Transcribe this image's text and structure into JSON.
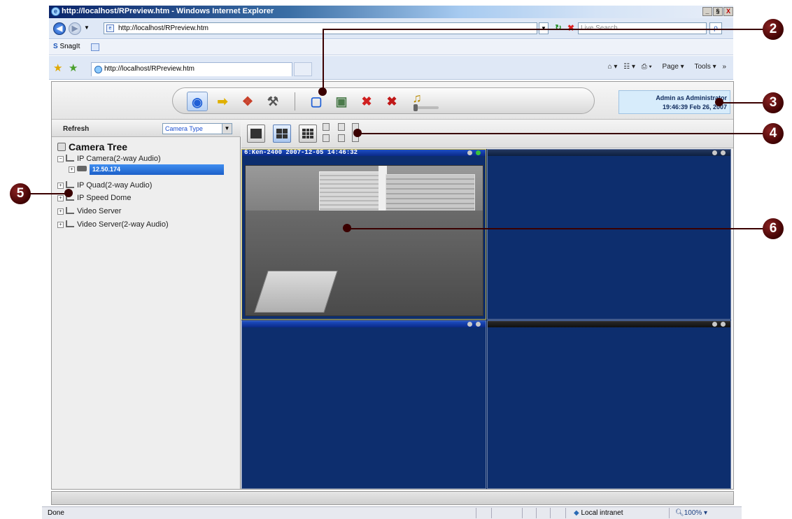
{
  "window": {
    "title": "http://localhost/RPreview.htm - Windows Internet Explorer",
    "min": "_",
    "max": "§",
    "close": "X"
  },
  "nav": {
    "address": "http://localhost/RPreview.htm",
    "search_placeholder": "Live Search",
    "back_glyph": "◀",
    "forward_glyph": "▶",
    "refresh_glyph": "↻",
    "stop_glyph": "✖",
    "search_glyph": "ρ"
  },
  "links": {
    "snagit": "SnagIt"
  },
  "favorites": {
    "tab_label": "http://localhost/RPreview.htm",
    "commands": [
      "Page",
      "Tools"
    ]
  },
  "toolbar": {
    "buttons": [
      {
        "name": "live-view",
        "icon": "eye-icon",
        "glyph": "◉",
        "color": "#1f5fd6"
      },
      {
        "name": "playback",
        "icon": "arrow-icon",
        "glyph": "➡",
        "color": "#e0b000"
      },
      {
        "name": "config",
        "icon": "puzzle-icon",
        "glyph": "❖",
        "color": "#c8402a"
      },
      {
        "name": "tools",
        "icon": "hammer-icon",
        "glyph": "⚒",
        "color": "#555555"
      },
      {
        "name": "fullscreen",
        "icon": "fullscreen-icon",
        "glyph": "▢",
        "color": "#1f5fd6"
      },
      {
        "name": "snapshot",
        "icon": "camera-icon",
        "glyph": "▣",
        "color": "#4a7a4a"
      },
      {
        "name": "disconnect",
        "icon": "disconnect-icon",
        "glyph": "✖",
        "color": "#d02020"
      },
      {
        "name": "disconnect-all",
        "icon": "disconnect-all-icon",
        "glyph": "✖",
        "color": "#c01818"
      },
      {
        "name": "audio",
        "icon": "speaker-icon",
        "glyph": "♫",
        "color": "#b88a00"
      }
    ]
  },
  "user": {
    "line1": "Admin as Administrator",
    "line2": "19:46:39 Feb 26, 2007"
  },
  "left_panel": {
    "refresh": "Refresh",
    "camera_type": "Camera Type",
    "tree_title": "Camera Tree",
    "nodes": [
      {
        "label": "IP Camera(2-way Audio)",
        "toggle": "−"
      },
      {
        "label": "IP Quad(2-way Audio)",
        "toggle": "+"
      },
      {
        "label": "IP Speed Dome",
        "toggle": "+"
      },
      {
        "label": "Video Server",
        "toggle": "+"
      },
      {
        "label": "Video Server(2-way Audio)",
        "toggle": "+"
      }
    ],
    "selected_child": "12.50.174",
    "selected_child_toggle": "+"
  },
  "video": {
    "pane1_title": "6:Ken-2400   2007-12-05 14:46:32"
  },
  "status": {
    "done": "Done",
    "zone": "Local intranet",
    "zoom": "100%"
  },
  "callouts": [
    "2",
    "3",
    "4",
    "5",
    "6"
  ],
  "colors": {
    "callout": "#3a0000",
    "video_bg": "#0d2e6e",
    "selection": "#1b5fc8"
  }
}
